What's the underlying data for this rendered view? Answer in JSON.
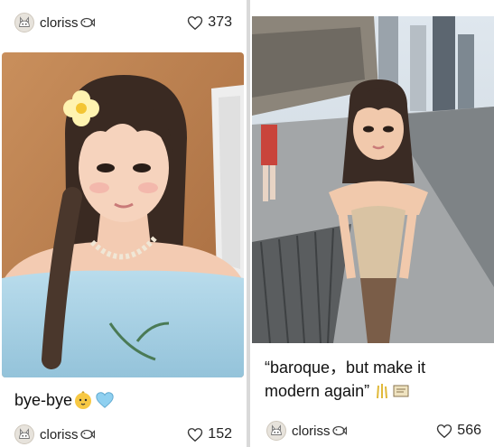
{
  "cards": [
    {
      "username": "cloriss",
      "likes": "373",
      "caption": "bye-bye",
      "caption_emoji": [
        "baby-chick",
        "blue-heart"
      ],
      "footer_username": "cloriss",
      "footer_likes": "152"
    },
    {
      "caption_line1": "“baroque，but make it",
      "caption_line2": "modern again”",
      "caption_emoji": [
        "sparkle",
        "scroll"
      ],
      "footer_username": "cloriss",
      "footer_likes": "566"
    }
  ],
  "colors": {
    "background": "#d9d9d9",
    "card": "#ffffff",
    "text": "#111111",
    "heart_outline": "#333333"
  }
}
